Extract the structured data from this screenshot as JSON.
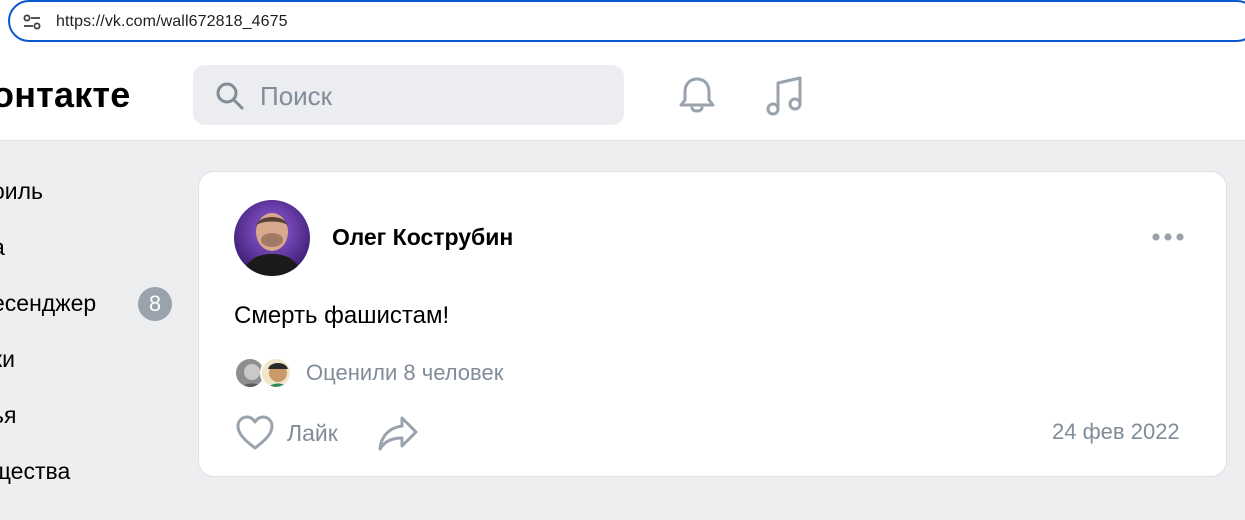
{
  "browser": {
    "url": "https://vk.com/wall672818_4675",
    "tune_icon": "tune-icon"
  },
  "header": {
    "logo_text": "онтакте",
    "search_placeholder": "Поиск",
    "icons": [
      "search-icon",
      "bell-icon",
      "music-icon"
    ]
  },
  "sidebar": {
    "items": [
      {
        "label": "оиль"
      },
      {
        "label": "а"
      },
      {
        "label": "есенджер",
        "badge": "8"
      },
      {
        "label": "ки"
      },
      {
        "label": "ья"
      },
      {
        "label": "щества"
      }
    ]
  },
  "post": {
    "author": "Олег Кострубин",
    "text": "Смерть фашистам!",
    "likes_summary": "Оценили 8 человек",
    "like_label": "Лайк",
    "date": "24 фев 2022",
    "more_icon": "more-dots-icon"
  },
  "colors": {
    "page_bg": "#edeef0",
    "card_bg": "#ffffff",
    "secondary_text": "#818c99",
    "badge_bg": "#99a2ad",
    "url_border": "#0b57d0"
  }
}
